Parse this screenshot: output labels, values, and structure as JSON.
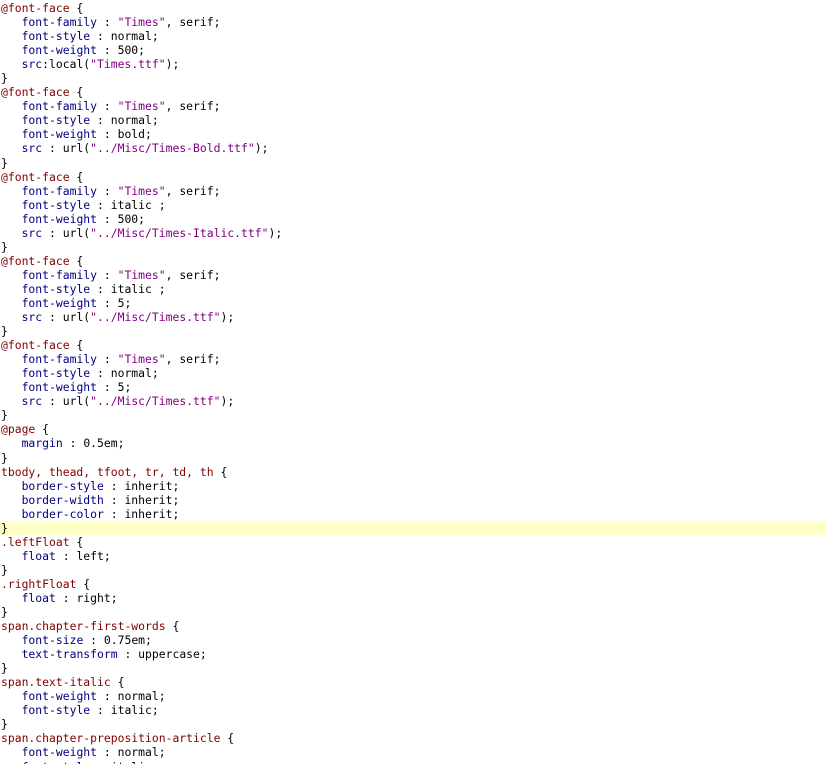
{
  "editor": {
    "current_line": 37,
    "colors": {
      "selector": "#800000",
      "property": "#000080",
      "string": "#800080",
      "text": "#000000",
      "current_line_bg": "#ffffc8"
    },
    "lines": [
      [
        {
          "t": "sel",
          "v": "@font-face"
        },
        {
          "t": "punc",
          "v": " {"
        }
      ],
      [
        {
          "t": "punc",
          "v": "   "
        },
        {
          "t": "prop",
          "v": "font-family"
        },
        {
          "t": "punc",
          "v": " : "
        },
        {
          "t": "str",
          "v": "\"Times\""
        },
        {
          "t": "val",
          "v": ", serif;"
        }
      ],
      [
        {
          "t": "punc",
          "v": "   "
        },
        {
          "t": "prop",
          "v": "font-style"
        },
        {
          "t": "punc",
          "v": " : "
        },
        {
          "t": "val",
          "v": "normal;"
        }
      ],
      [
        {
          "t": "punc",
          "v": "   "
        },
        {
          "t": "prop",
          "v": "font-weight"
        },
        {
          "t": "punc",
          "v": " : "
        },
        {
          "t": "val",
          "v": "500;"
        }
      ],
      [
        {
          "t": "punc",
          "v": "   "
        },
        {
          "t": "prop",
          "v": "src"
        },
        {
          "t": "val",
          "v": ":local("
        },
        {
          "t": "str",
          "v": "\"Times.ttf\""
        },
        {
          "t": "val",
          "v": ");"
        }
      ],
      [
        {
          "t": "punc",
          "v": "}"
        }
      ],
      [
        {
          "t": "sel",
          "v": "@font-face"
        },
        {
          "t": "punc",
          "v": " {"
        }
      ],
      [
        {
          "t": "punc",
          "v": "   "
        },
        {
          "t": "prop",
          "v": "font-family"
        },
        {
          "t": "punc",
          "v": " : "
        },
        {
          "t": "str",
          "v": "\"Times\""
        },
        {
          "t": "val",
          "v": ", serif;"
        }
      ],
      [
        {
          "t": "punc",
          "v": "   "
        },
        {
          "t": "prop",
          "v": "font-style"
        },
        {
          "t": "punc",
          "v": " : "
        },
        {
          "t": "val",
          "v": "normal;"
        }
      ],
      [
        {
          "t": "punc",
          "v": "   "
        },
        {
          "t": "prop",
          "v": "font-weight"
        },
        {
          "t": "punc",
          "v": " : "
        },
        {
          "t": "val",
          "v": "bold;"
        }
      ],
      [
        {
          "t": "punc",
          "v": "   "
        },
        {
          "t": "prop",
          "v": "src"
        },
        {
          "t": "punc",
          "v": " : "
        },
        {
          "t": "val",
          "v": "url("
        },
        {
          "t": "str",
          "v": "\"../Misc/Times-Bold.ttf\""
        },
        {
          "t": "val",
          "v": ");"
        }
      ],
      [
        {
          "t": "punc",
          "v": "}"
        }
      ],
      [
        {
          "t": "sel",
          "v": "@font-face"
        },
        {
          "t": "punc",
          "v": " {"
        }
      ],
      [
        {
          "t": "punc",
          "v": "   "
        },
        {
          "t": "prop",
          "v": "font-family"
        },
        {
          "t": "punc",
          "v": " : "
        },
        {
          "t": "str",
          "v": "\"Times\""
        },
        {
          "t": "val",
          "v": ", serif;"
        }
      ],
      [
        {
          "t": "punc",
          "v": "   "
        },
        {
          "t": "prop",
          "v": "font-style"
        },
        {
          "t": "punc",
          "v": " : "
        },
        {
          "t": "val",
          "v": "italic ;"
        }
      ],
      [
        {
          "t": "punc",
          "v": "   "
        },
        {
          "t": "prop",
          "v": "font-weight"
        },
        {
          "t": "punc",
          "v": " : "
        },
        {
          "t": "val",
          "v": "500;"
        }
      ],
      [
        {
          "t": "punc",
          "v": "   "
        },
        {
          "t": "prop",
          "v": "src"
        },
        {
          "t": "punc",
          "v": " : "
        },
        {
          "t": "val",
          "v": "url("
        },
        {
          "t": "str",
          "v": "\"../Misc/Times-Italic.ttf\""
        },
        {
          "t": "val",
          "v": ");"
        }
      ],
      [
        {
          "t": "punc",
          "v": "}"
        }
      ],
      [
        {
          "t": "sel",
          "v": "@font-face"
        },
        {
          "t": "punc",
          "v": " {"
        }
      ],
      [
        {
          "t": "punc",
          "v": "   "
        },
        {
          "t": "prop",
          "v": "font-family"
        },
        {
          "t": "punc",
          "v": " : "
        },
        {
          "t": "str",
          "v": "\"Times\""
        },
        {
          "t": "val",
          "v": ", serif;"
        }
      ],
      [
        {
          "t": "punc",
          "v": "   "
        },
        {
          "t": "prop",
          "v": "font-style"
        },
        {
          "t": "punc",
          "v": " : "
        },
        {
          "t": "val",
          "v": "italic ;"
        }
      ],
      [
        {
          "t": "punc",
          "v": "   "
        },
        {
          "t": "prop",
          "v": "font-weight"
        },
        {
          "t": "punc",
          "v": " : "
        },
        {
          "t": "val",
          "v": "5;"
        }
      ],
      [
        {
          "t": "punc",
          "v": "   "
        },
        {
          "t": "prop",
          "v": "src"
        },
        {
          "t": "punc",
          "v": " : "
        },
        {
          "t": "val",
          "v": "url("
        },
        {
          "t": "str",
          "v": "\"../Misc/Times.ttf\""
        },
        {
          "t": "val",
          "v": ");"
        }
      ],
      [
        {
          "t": "punc",
          "v": "}"
        }
      ],
      [
        {
          "t": "sel",
          "v": "@font-face"
        },
        {
          "t": "punc",
          "v": " {"
        }
      ],
      [
        {
          "t": "punc",
          "v": "   "
        },
        {
          "t": "prop",
          "v": "font-family"
        },
        {
          "t": "punc",
          "v": " : "
        },
        {
          "t": "str",
          "v": "\"Times\""
        },
        {
          "t": "val",
          "v": ", serif;"
        }
      ],
      [
        {
          "t": "punc",
          "v": "   "
        },
        {
          "t": "prop",
          "v": "font-style"
        },
        {
          "t": "punc",
          "v": " : "
        },
        {
          "t": "val",
          "v": "normal;"
        }
      ],
      [
        {
          "t": "punc",
          "v": "   "
        },
        {
          "t": "prop",
          "v": "font-weight"
        },
        {
          "t": "punc",
          "v": " : "
        },
        {
          "t": "val",
          "v": "5;"
        }
      ],
      [
        {
          "t": "punc",
          "v": "   "
        },
        {
          "t": "prop",
          "v": "src"
        },
        {
          "t": "punc",
          "v": " : "
        },
        {
          "t": "val",
          "v": "url("
        },
        {
          "t": "str",
          "v": "\"../Misc/Times.ttf\""
        },
        {
          "t": "val",
          "v": ");"
        }
      ],
      [
        {
          "t": "punc",
          "v": "}"
        }
      ],
      [
        {
          "t": "sel",
          "v": "@page"
        },
        {
          "t": "punc",
          "v": " {"
        }
      ],
      [
        {
          "t": "punc",
          "v": "   "
        },
        {
          "t": "prop",
          "v": "margin"
        },
        {
          "t": "punc",
          "v": " : "
        },
        {
          "t": "val",
          "v": "0.5em;"
        }
      ],
      [
        {
          "t": "punc",
          "v": "}"
        }
      ],
      [
        {
          "t": "sel",
          "v": "tbody, thead, tfoot, tr, td, th"
        },
        {
          "t": "punc",
          "v": " {"
        }
      ],
      [
        {
          "t": "punc",
          "v": "   "
        },
        {
          "t": "prop",
          "v": "border-style"
        },
        {
          "t": "punc",
          "v": " : "
        },
        {
          "t": "val",
          "v": "inherit;"
        }
      ],
      [
        {
          "t": "punc",
          "v": "   "
        },
        {
          "t": "prop",
          "v": "border-width"
        },
        {
          "t": "punc",
          "v": " : "
        },
        {
          "t": "val",
          "v": "inherit;"
        }
      ],
      [
        {
          "t": "punc",
          "v": "   "
        },
        {
          "t": "prop",
          "v": "border-color"
        },
        {
          "t": "punc",
          "v": " : "
        },
        {
          "t": "val",
          "v": "inherit;"
        }
      ],
      [
        {
          "t": "punc",
          "v": "}"
        }
      ],
      [
        {
          "t": "sel",
          "v": ".leftFloat"
        },
        {
          "t": "punc",
          "v": " {"
        }
      ],
      [
        {
          "t": "punc",
          "v": "   "
        },
        {
          "t": "prop",
          "v": "float"
        },
        {
          "t": "punc",
          "v": " : "
        },
        {
          "t": "val",
          "v": "left;"
        }
      ],
      [
        {
          "t": "punc",
          "v": "}"
        }
      ],
      [
        {
          "t": "sel",
          "v": ".rightFloat"
        },
        {
          "t": "punc",
          "v": " {"
        }
      ],
      [
        {
          "t": "punc",
          "v": "   "
        },
        {
          "t": "prop",
          "v": "float"
        },
        {
          "t": "punc",
          "v": " : "
        },
        {
          "t": "val",
          "v": "right;"
        }
      ],
      [
        {
          "t": "punc",
          "v": "}"
        }
      ],
      [
        {
          "t": "sel",
          "v": "span.chapter-first-words"
        },
        {
          "t": "punc",
          "v": " {"
        }
      ],
      [
        {
          "t": "punc",
          "v": "   "
        },
        {
          "t": "prop",
          "v": "font-size"
        },
        {
          "t": "punc",
          "v": " : "
        },
        {
          "t": "val",
          "v": "0.75em;"
        }
      ],
      [
        {
          "t": "punc",
          "v": "   "
        },
        {
          "t": "prop",
          "v": "text-transform"
        },
        {
          "t": "punc",
          "v": " : "
        },
        {
          "t": "val",
          "v": "uppercase;"
        }
      ],
      [
        {
          "t": "punc",
          "v": "}"
        }
      ],
      [
        {
          "t": "sel",
          "v": "span.text-italic"
        },
        {
          "t": "punc",
          "v": " {"
        }
      ],
      [
        {
          "t": "punc",
          "v": "   "
        },
        {
          "t": "prop",
          "v": "font-weight"
        },
        {
          "t": "punc",
          "v": " : "
        },
        {
          "t": "val",
          "v": "normal;"
        }
      ],
      [
        {
          "t": "punc",
          "v": "   "
        },
        {
          "t": "prop",
          "v": "font-style"
        },
        {
          "t": "punc",
          "v": " : "
        },
        {
          "t": "val",
          "v": "italic;"
        }
      ],
      [
        {
          "t": "punc",
          "v": "}"
        }
      ],
      [
        {
          "t": "sel",
          "v": "span.chapter-preposition-article"
        },
        {
          "t": "punc",
          "v": " {"
        }
      ],
      [
        {
          "t": "punc",
          "v": "   "
        },
        {
          "t": "prop",
          "v": "font-weight"
        },
        {
          "t": "punc",
          "v": " : "
        },
        {
          "t": "val",
          "v": "normal;"
        }
      ],
      [
        {
          "t": "punc",
          "v": "   "
        },
        {
          "t": "prop",
          "v": "font-style"
        },
        {
          "t": "punc",
          "v": " : "
        },
        {
          "t": "val",
          "v": "italic;"
        }
      ]
    ]
  }
}
